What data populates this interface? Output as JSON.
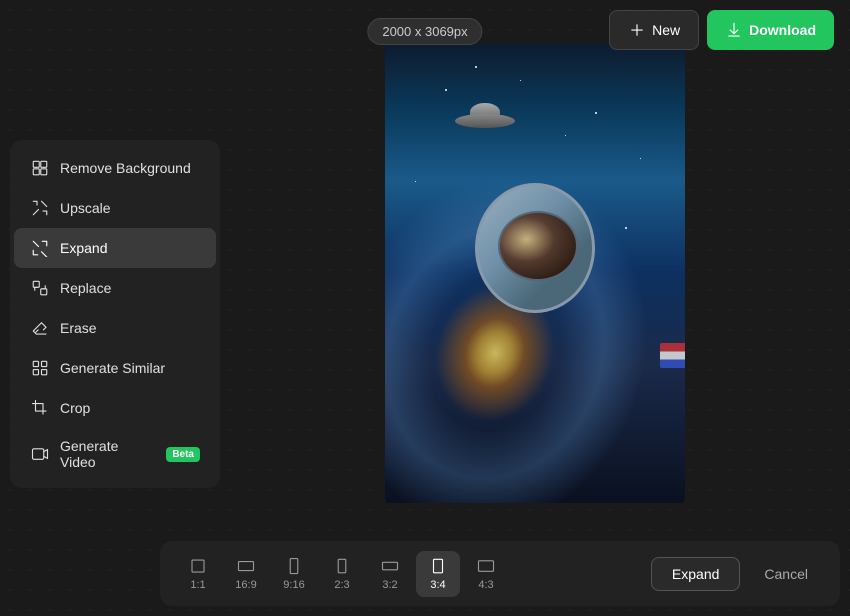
{
  "header": {
    "dimensions_label": "2000 x 3069px",
    "new_button_label": "New",
    "download_button_label": "Download"
  },
  "sidebar": {
    "items": [
      {
        "id": "remove-background",
        "label": "Remove Background",
        "icon": "remove-bg-icon",
        "active": false
      },
      {
        "id": "upscale",
        "label": "Upscale",
        "icon": "upscale-icon",
        "active": false
      },
      {
        "id": "expand",
        "label": "Expand",
        "icon": "expand-icon",
        "active": true
      },
      {
        "id": "replace",
        "label": "Replace",
        "icon": "replace-icon",
        "active": false
      },
      {
        "id": "erase",
        "label": "Erase",
        "icon": "erase-icon",
        "active": false
      },
      {
        "id": "generate-similar",
        "label": "Generate Similar",
        "icon": "generate-similar-icon",
        "active": false
      },
      {
        "id": "crop",
        "label": "Crop",
        "icon": "crop-icon",
        "active": false
      },
      {
        "id": "generate-video",
        "label": "Generate Video",
        "icon": "generate-video-icon",
        "active": false,
        "badge": "Beta"
      }
    ]
  },
  "toolbar": {
    "ratios": [
      {
        "id": "1-1",
        "label": "1:1",
        "active": false
      },
      {
        "id": "16-9",
        "label": "16:9",
        "active": false
      },
      {
        "id": "9-16",
        "label": "9:16",
        "active": false
      },
      {
        "id": "2-3",
        "label": "2:3",
        "active": false
      },
      {
        "id": "3-2",
        "label": "3:2",
        "active": false
      },
      {
        "id": "3-4",
        "label": "3:4",
        "active": true
      },
      {
        "id": "4-3",
        "label": "4:3",
        "active": false
      }
    ],
    "expand_label": "Expand",
    "cancel_label": "Cancel"
  },
  "colors": {
    "accent_green": "#22c55e",
    "active_bg": "#3a3a3a",
    "sidebar_bg": "#222222",
    "body_bg": "#1a1a1a",
    "beta_badge": "#22c55e"
  }
}
